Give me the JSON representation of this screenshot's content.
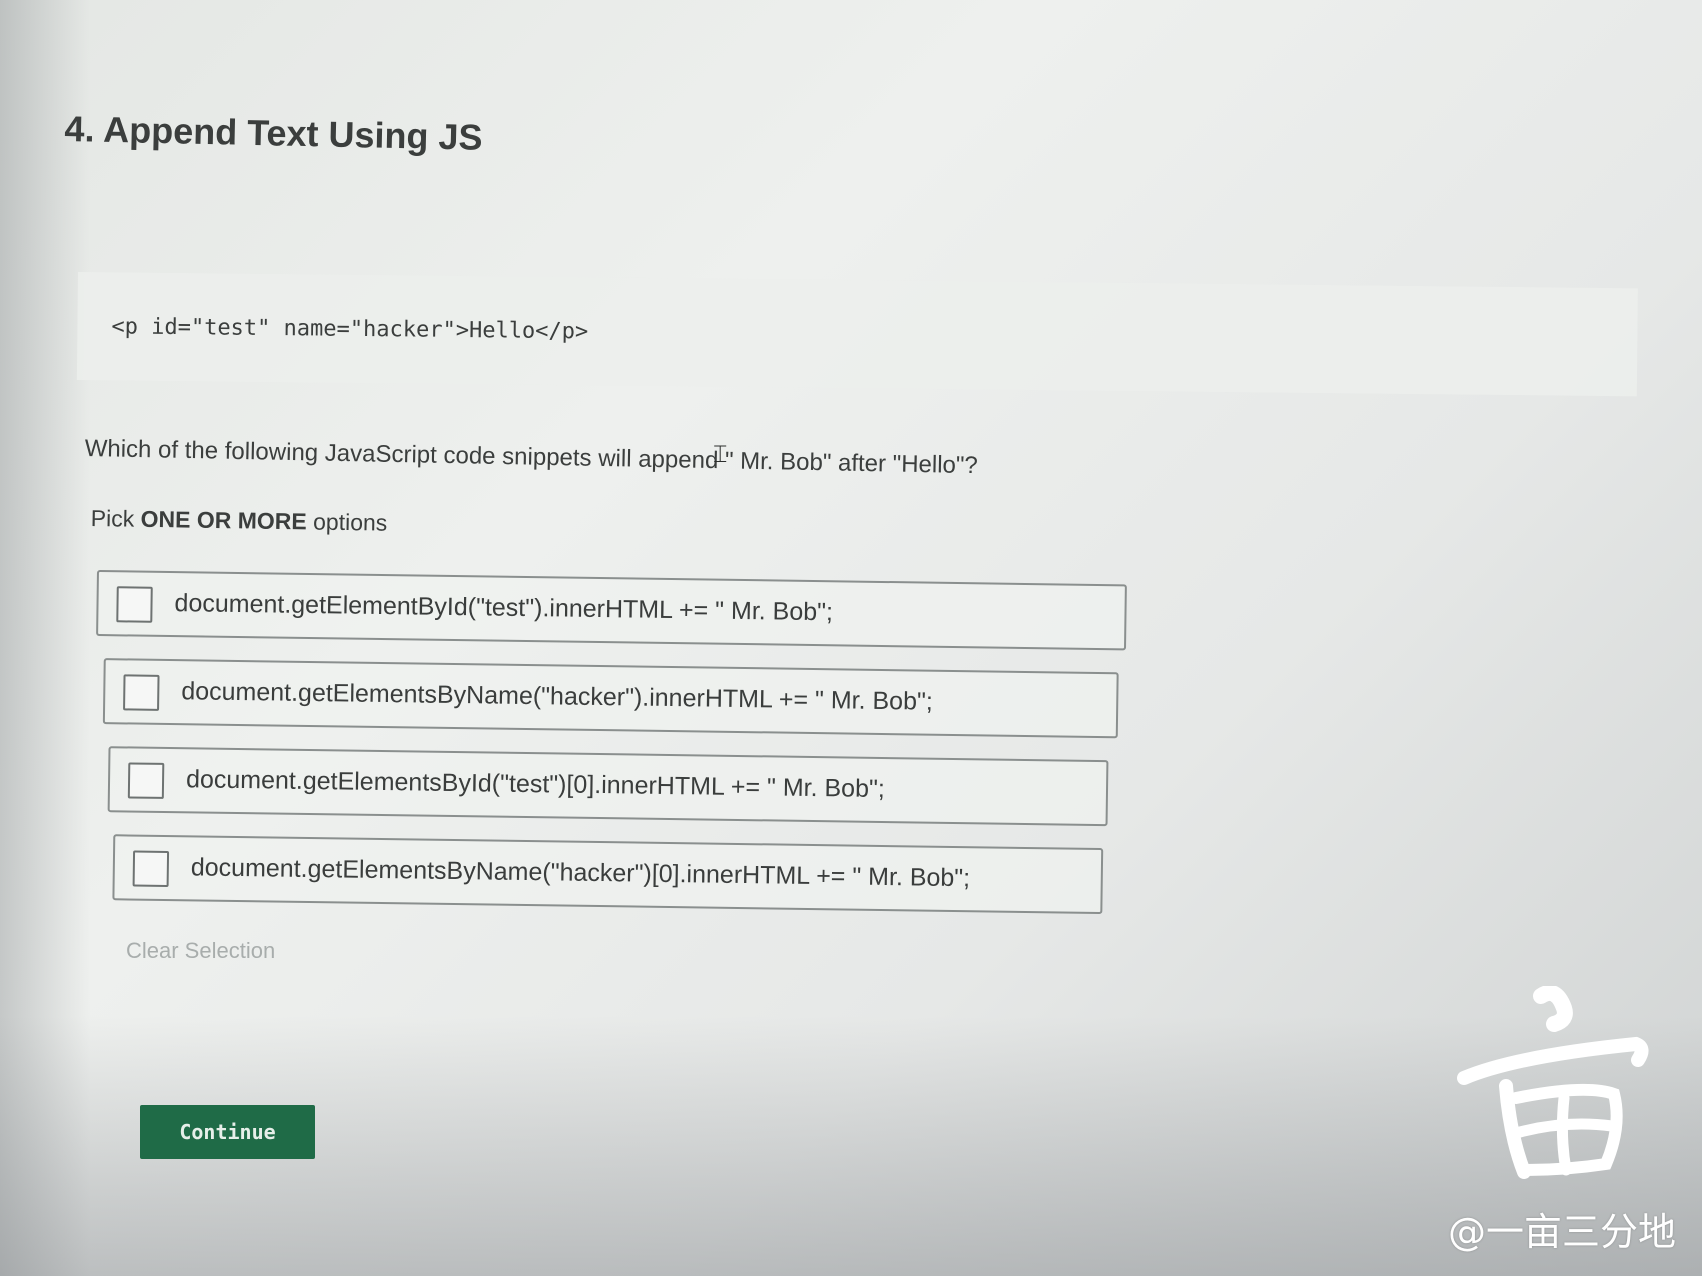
{
  "question": {
    "title": "4. Append Text Using JS",
    "code": "<p id=\"test\" name=\"hacker\">Hello</p>",
    "prompt": "Which of the following JavaScript code snippets will append \" Mr. Bob\" after \"Hello\"?",
    "instruction": {
      "prefix": "Pick ",
      "emphasis": "ONE OR MORE",
      "suffix": " options"
    }
  },
  "options": [
    {
      "label": "document.getElementById(\"test\").innerHTML += \" Mr. Bob\";",
      "checked": false
    },
    {
      "label": "document.getElementsByName(\"hacker\").innerHTML += \" Mr. Bob\";",
      "checked": false
    },
    {
      "label": "document.getElementsById(\"test\")[0].innerHTML += \" Mr. Bob\";",
      "checked": false
    },
    {
      "label": "document.getElementsByName(\"hacker\")[0].innerHTML += \" Mr. Bob\";",
      "checked": false
    }
  ],
  "clear_selection_label": "Clear Selection",
  "continue_label": "Continue",
  "watermark": {
    "handle": "@一亩三分地"
  },
  "colors": {
    "continue_button": "#1f6b47",
    "clear_selection": "#a8adac",
    "text": "#3b3e3d"
  },
  "icons": {
    "cursor": "text-cursor-icon",
    "checkbox": "checkbox-icon"
  }
}
